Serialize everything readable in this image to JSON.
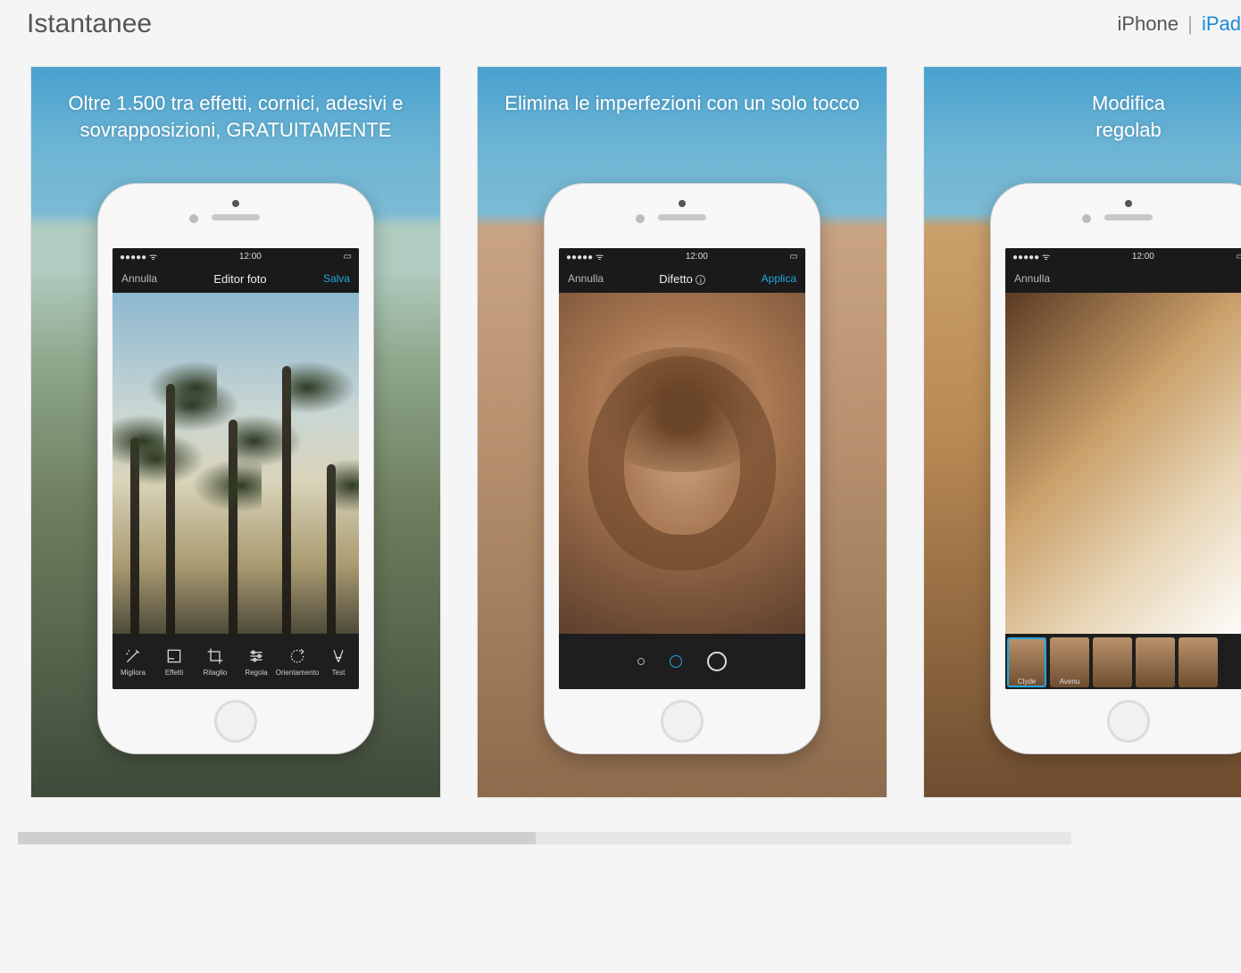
{
  "header": {
    "title": "Istantanee",
    "device_iphone": "iPhone",
    "device_ipad": "iPad"
  },
  "status": {
    "time": "12:00"
  },
  "cards": [
    {
      "caption": "Oltre 1.500 tra effetti, cornici, adesivi e sovrapposizioni, GRATUITAMENTE",
      "nav_left": "Annulla",
      "nav_title": "Editor foto",
      "nav_right": "Salva",
      "tools": [
        {
          "key": "migliora",
          "label": "Migliora"
        },
        {
          "key": "effetti",
          "label": "Effetti"
        },
        {
          "key": "ritaglio",
          "label": "Ritaglio"
        },
        {
          "key": "regola",
          "label": "Regola"
        },
        {
          "key": "orientamento",
          "label": "Orientamento"
        },
        {
          "key": "testo",
          "label": "Test"
        }
      ]
    },
    {
      "caption": "Elimina le imperfezioni con un solo tocco",
      "nav_left": "Annulla",
      "nav_title": "Difetto",
      "nav_right": "Applica"
    },
    {
      "caption": "Modifica\nregolab",
      "nav_left": "Annulla",
      "filters": [
        {
          "label": "Clyde"
        },
        {
          "label": "Avenu"
        }
      ]
    }
  ]
}
